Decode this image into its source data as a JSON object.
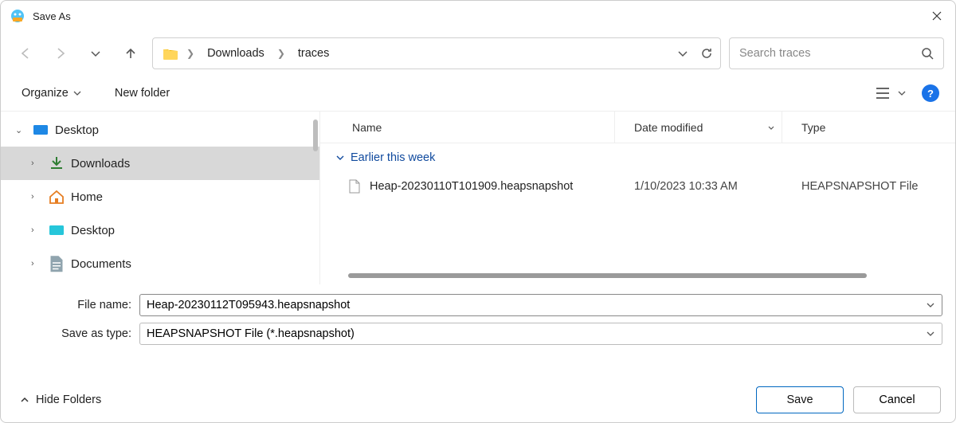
{
  "window": {
    "title": "Save As"
  },
  "nav": {
    "breadcrumbs": [
      "Downloads",
      "traces"
    ]
  },
  "search": {
    "placeholder": "Search traces"
  },
  "toolbar": {
    "organize_label": "Organize",
    "new_folder_label": "New folder"
  },
  "sidebar": {
    "items": [
      {
        "label": "Desktop",
        "icon": "desktop-blue",
        "expanded": true,
        "depth": 0
      },
      {
        "label": "Downloads",
        "icon": "download-green",
        "selected": true,
        "depth": 1
      },
      {
        "label": "Home",
        "icon": "home-orange",
        "depth": 1
      },
      {
        "label": "Desktop",
        "icon": "desktop-cyan",
        "depth": 1
      },
      {
        "label": "Documents",
        "icon": "document-gray",
        "depth": 1
      }
    ]
  },
  "filelist": {
    "columns": {
      "name": "Name",
      "modified": "Date modified",
      "type": "Type"
    },
    "group_header": "Earlier this week",
    "rows": [
      {
        "name": "Heap-20230110T101909.heapsnapshot",
        "modified": "1/10/2023 10:33 AM",
        "type": "HEAPSNAPSHOT File"
      }
    ]
  },
  "form": {
    "filename_label": "File name:",
    "filename_value": "Heap-20230112T095943.heapsnapshot",
    "savetype_label": "Save as type:",
    "savetype_value": "HEAPSNAPSHOT File (*.heapsnapshot)"
  },
  "footer": {
    "hide_folders_label": "Hide Folders",
    "save_label": "Save",
    "cancel_label": "Cancel"
  }
}
